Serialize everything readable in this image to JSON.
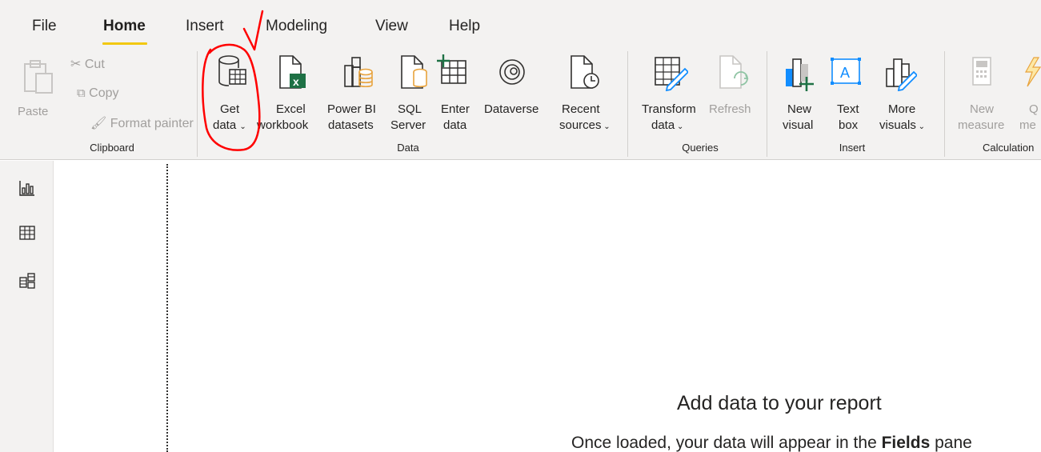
{
  "tabs": [
    {
      "label": "File"
    },
    {
      "label": "Home"
    },
    {
      "label": "Insert"
    },
    {
      "label": "Modeling"
    },
    {
      "label": "View"
    },
    {
      "label": "Help"
    }
  ],
  "clipboard": {
    "paste": "Paste",
    "cut": "Cut",
    "copy": "Copy",
    "format_painter": "Format painter",
    "group_label": "Clipboard"
  },
  "data_group": {
    "get_data": [
      "Get",
      "data"
    ],
    "excel": [
      "Excel",
      "workbook"
    ],
    "powerbi": [
      "Power BI",
      "datasets"
    ],
    "sql": [
      "SQL",
      "Server"
    ],
    "enter": [
      "Enter",
      "data"
    ],
    "dataverse": "Dataverse",
    "recent": [
      "Recent",
      "sources"
    ],
    "group_label": "Data"
  },
  "queries": {
    "transform": [
      "Transform",
      "data"
    ],
    "refresh": "Refresh",
    "group_label": "Queries"
  },
  "insert_group": {
    "new_visual": [
      "New",
      "visual"
    ],
    "text_box": [
      "Text",
      "box"
    ],
    "more_visuals": [
      "More",
      "visuals"
    ],
    "group_label": "Insert"
  },
  "calculations": {
    "new_measure": [
      "New",
      "measure"
    ],
    "quick_measure": [
      "Q",
      "me"
    ],
    "group_label": "Calculation"
  },
  "canvas": {
    "title": "Add data to your report",
    "subtitle_prefix": "Once loaded, your data will appear in the ",
    "subtitle_bold": "Fields",
    "subtitle_suffix": " pane"
  },
  "colors": {
    "accent": "#f2c811",
    "excel_green": "#1e7145",
    "icon_orange": "#e8a33d",
    "visual_blue": "#118dff",
    "annotation_red": "#ff0000"
  }
}
